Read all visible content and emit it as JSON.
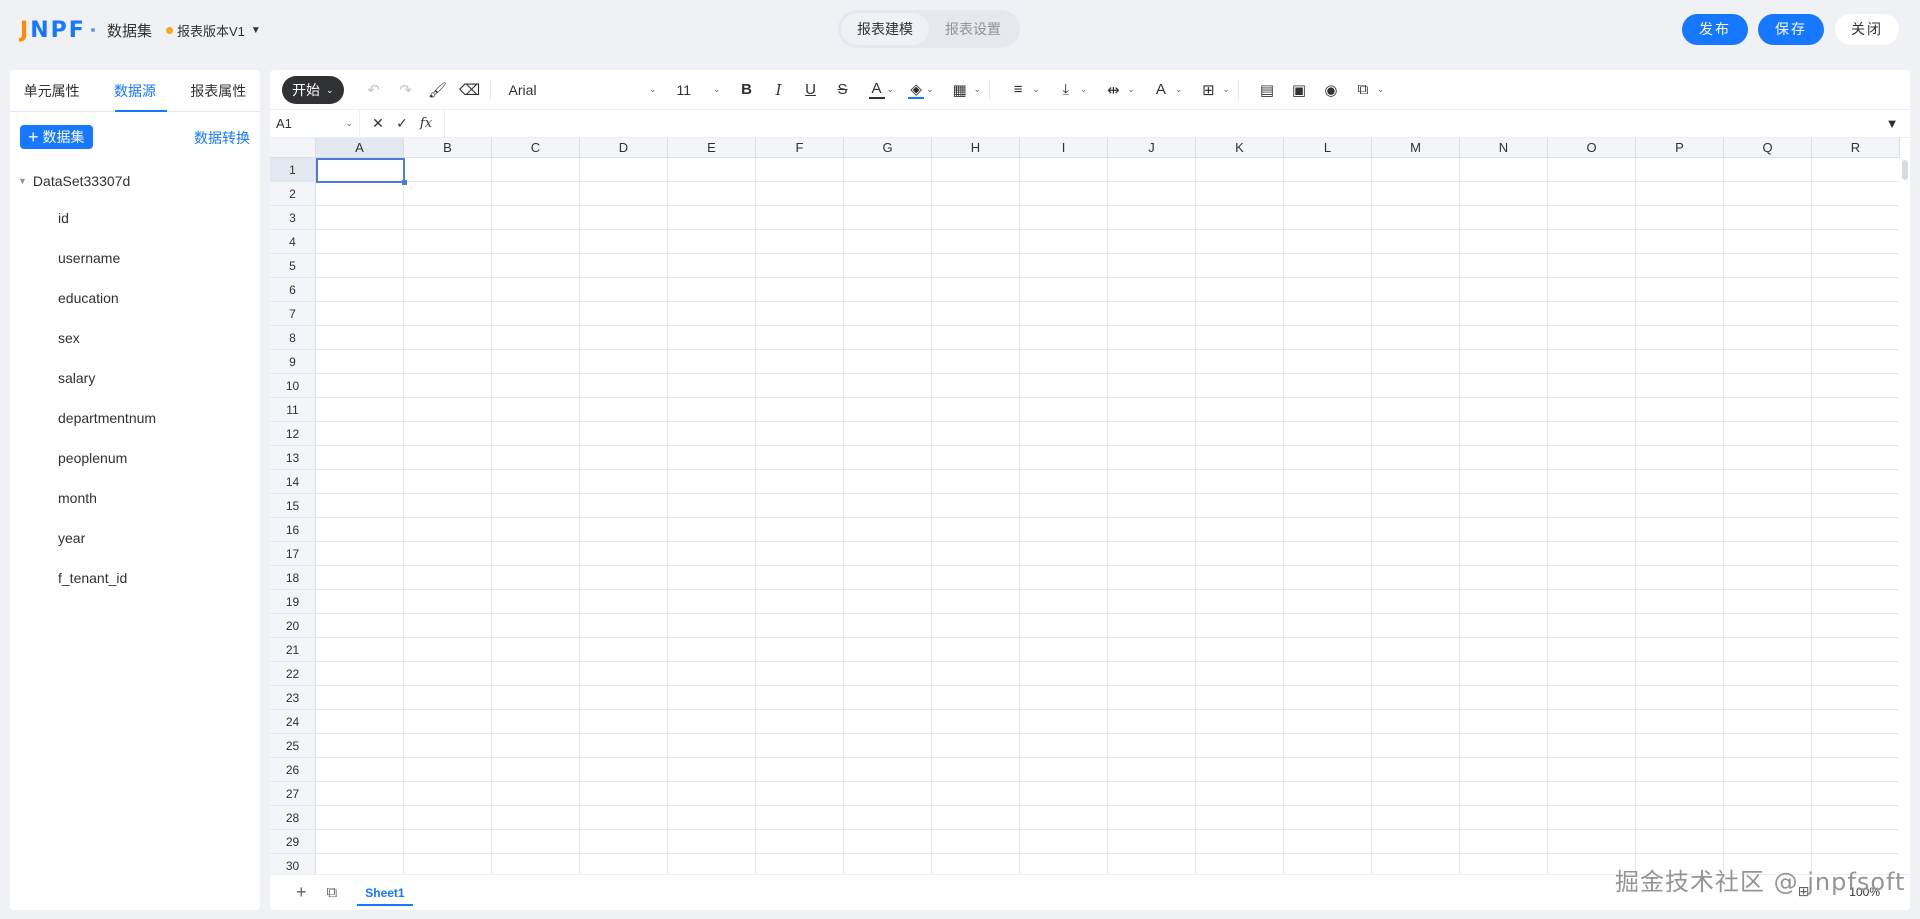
{
  "header": {
    "logo": "JNPF",
    "app_title": "数据集",
    "version_label": "报表版本V1",
    "mode_tabs": [
      {
        "label": "报表建模",
        "active": true
      },
      {
        "label": "报表设置",
        "active": false
      }
    ],
    "publish_label": "发布",
    "save_label": "保存",
    "close_label": "关闭"
  },
  "left_panel": {
    "tabs": [
      {
        "label": "单元属性",
        "active": false
      },
      {
        "label": "数据源",
        "active": true
      },
      {
        "label": "报表属性",
        "active": false
      }
    ],
    "add_dataset_label": "数据集",
    "convert_label": "数据转换",
    "dataset": {
      "name": "DataSet33307d",
      "fields": [
        "id",
        "username",
        "education",
        "sex",
        "salary",
        "departmentnum",
        "peoplenum",
        "month",
        "year",
        "f_tenant_id"
      ]
    }
  },
  "toolbar": {
    "start_label": "开始",
    "font_family": "Arial",
    "font_size": "11"
  },
  "formula_bar": {
    "cell_ref": "A1",
    "fx_label": "fx",
    "value": ""
  },
  "grid": {
    "columns": [
      "A",
      "B",
      "C",
      "D",
      "E",
      "F",
      "G",
      "H",
      "I",
      "J",
      "K",
      "L",
      "M",
      "N",
      "O",
      "P",
      "Q",
      "R"
    ],
    "rows": [
      "1",
      "2",
      "3",
      "4",
      "5",
      "6",
      "7",
      "8",
      "9",
      "10",
      "11",
      "12",
      "13",
      "14",
      "15",
      "16",
      "17",
      "18",
      "19",
      "20",
      "21",
      "22",
      "23",
      "24",
      "25",
      "26",
      "27",
      "28",
      "29",
      "30"
    ],
    "selected_cell": "A1"
  },
  "sheet_bar": {
    "sheets": [
      "Sheet1"
    ],
    "zoom": "100%"
  },
  "watermark": "掘金技术社区 @ jnpfsoft",
  "colors": {
    "accent": "#1677ff",
    "dark": "#303133",
    "background": "#f0f1f5"
  }
}
